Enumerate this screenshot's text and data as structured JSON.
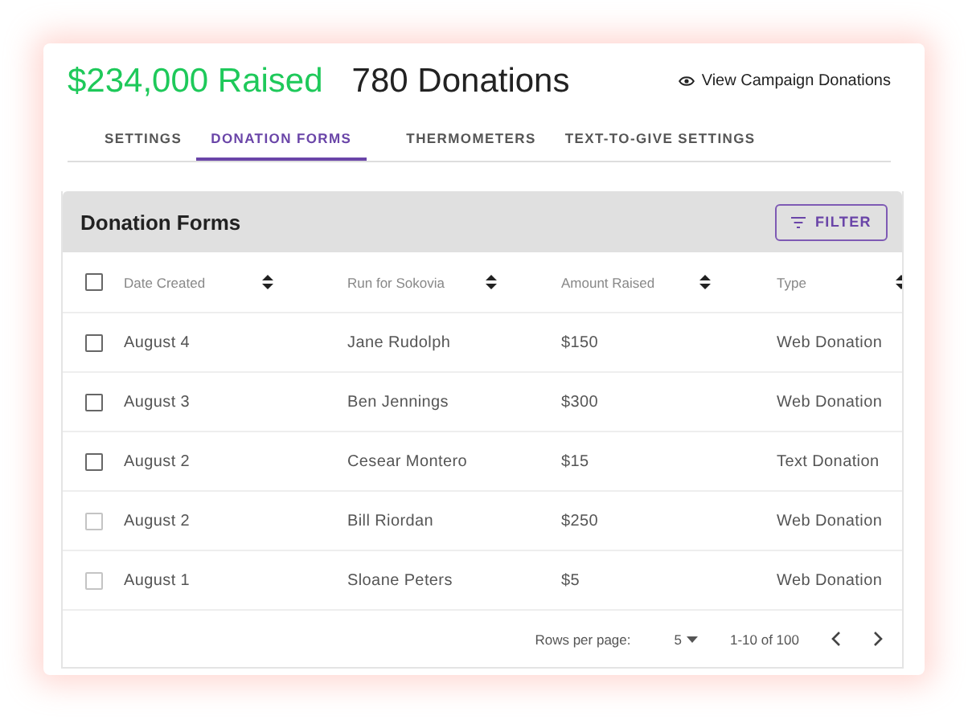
{
  "summary": {
    "raised": "$234,000 Raised",
    "donations": "780 Donations",
    "view_link": "View Campaign Donations"
  },
  "tabs": [
    {
      "label": "SETTINGS",
      "selected": false
    },
    {
      "label": "DONATION FORMS",
      "selected": true
    },
    {
      "label": "THERMOMETERS",
      "selected": false
    },
    {
      "label": "TEXT-TO-GIVE SETTINGS",
      "selected": false
    }
  ],
  "table": {
    "title": "Donation Forms",
    "filter_button": "FILTER",
    "select_all_checked": false,
    "columns": [
      "Date Created",
      "Run for Sokovia",
      "Amount Raised",
      "Type"
    ],
    "rows": [
      {
        "checked": false,
        "disabled": false,
        "cells": [
          "August 4",
          "Jane Rudolph",
          "$150",
          "Web Donation"
        ]
      },
      {
        "checked": false,
        "disabled": false,
        "cells": [
          "August 3",
          "Ben Jennings",
          "$300",
          "Web Donation"
        ]
      },
      {
        "checked": false,
        "disabled": false,
        "cells": [
          "August 2",
          "Cesear Montero",
          "$15",
          "Text Donation"
        ]
      },
      {
        "checked": false,
        "disabled": true,
        "cells": [
          "August 2",
          "Bill Riordan",
          "$250",
          "Web Donation"
        ]
      },
      {
        "checked": false,
        "disabled": true,
        "cells": [
          "August 1",
          "Sloane Peters",
          "$5",
          "Web Donation"
        ]
      }
    ],
    "pagination": {
      "rows_label": "Rows per page:",
      "rows_value": "5",
      "range": "1-10 of 100"
    }
  }
}
